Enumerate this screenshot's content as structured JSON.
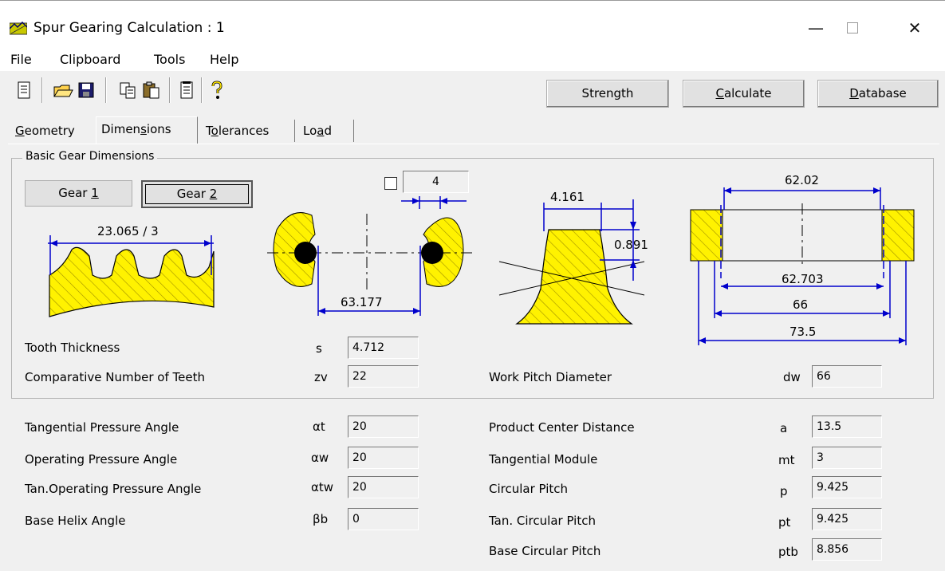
{
  "window": {
    "title": "Spur Gearing Calculation : 1"
  },
  "menu": [
    "File",
    "Clipboard",
    "Tools",
    "Help"
  ],
  "toolbar": {
    "strength": "Strength",
    "calculate": "Calculate",
    "database": "Database"
  },
  "tabs": [
    "Geometry",
    "Dimensions",
    "Tolerances",
    "Load"
  ],
  "group": {
    "title": "Basic Gear Dimensions",
    "gear1": "Gear 1",
    "gear2": "Gear 2",
    "checkbox_value": "4"
  },
  "drawings": {
    "tooth_span": "23.065 / 3",
    "center_distance": "63.177",
    "tooth_width": "4.161",
    "tooth_height": "0.891",
    "face_top": "62.02",
    "face_d1": "62.703",
    "face_d2": "66",
    "face_d3": "73.5"
  },
  "rows_top": [
    {
      "label": "Tooth Thickness",
      "symbol": "s",
      "value": "4.712"
    },
    {
      "label": "Comparative Number of Teeth",
      "symbol": "zv",
      "value": "22"
    }
  ],
  "work_pitch": {
    "label": "Work Pitch Diameter",
    "symbol": "dw",
    "value": "66"
  },
  "left_rows": [
    {
      "label": "Tangential Pressure Angle",
      "symbol": "αt",
      "value": "20"
    },
    {
      "label": "Operating Pressure Angle",
      "symbol": "αw",
      "value": "20"
    },
    {
      "label": "Tan.Operating Pressure Angle",
      "symbol": "αtw",
      "value": "20"
    },
    {
      "label": "Base Helix Angle",
      "symbol": "βb",
      "value": "0"
    }
  ],
  "right_rows": [
    {
      "label": "Product Center Distance",
      "symbol": "a",
      "value": "13.5"
    },
    {
      "label": "Tangential Module",
      "symbol": "mt",
      "value": "3"
    },
    {
      "label": "Circular Pitch",
      "symbol": "p",
      "value": "9.425"
    },
    {
      "label": "Tan. Circular Pitch",
      "symbol": "pt",
      "value": "9.425"
    },
    {
      "label": "Base Circular Pitch",
      "symbol": "ptb",
      "value": "8.856"
    }
  ],
  "colors": {
    "gear_fill": "#fff200",
    "dimension": "#0000cc"
  }
}
